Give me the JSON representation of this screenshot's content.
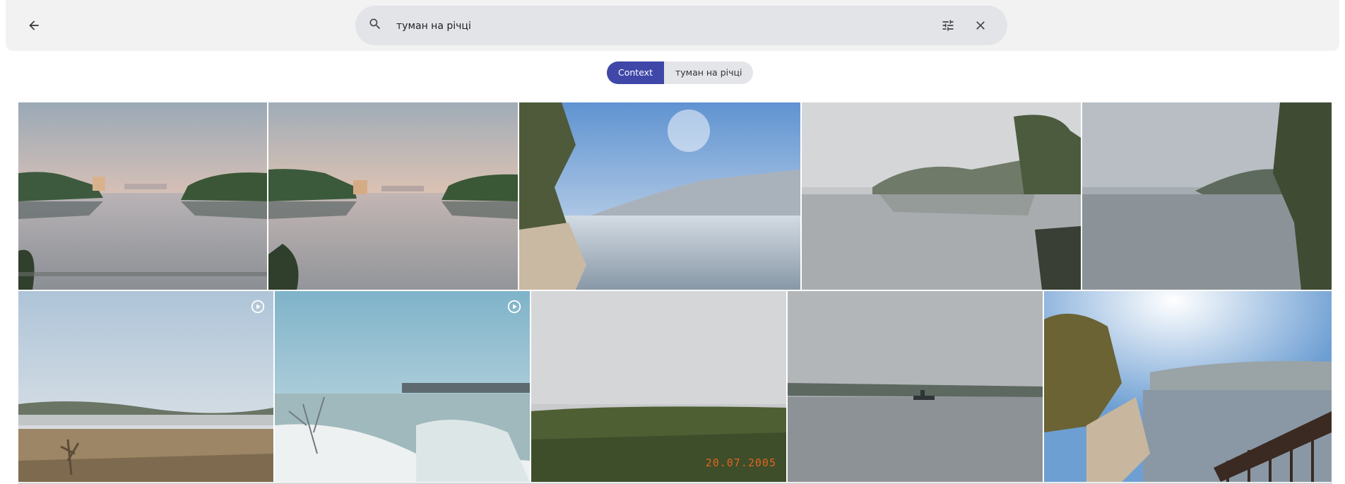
{
  "search": {
    "query": "туман на річці"
  },
  "chips": {
    "context_label": "Context",
    "query_label": "туман на річці"
  },
  "icons": {
    "back": "arrow-back-icon",
    "search": "search-icon",
    "tune": "tune-icon",
    "clear": "close-icon",
    "video": "play-circle-icon"
  },
  "colors": {
    "accent": "#3f48a8",
    "date_stamp": "#e0651f"
  },
  "photos": {
    "row1": [
      "foggy-river-dawn-city",
      "foggy-river-dawn-city-2",
      "river-bank-sunlit-haze",
      "misty-river-trees",
      "misty-river-willow"
    ],
    "row2": [
      "foggy-field-dawn",
      "frosty-river-bridge",
      "fog-over-meadow",
      "river-boat-in-fog",
      "embankment-railing-sun"
    ],
    "row2_video_flags": [
      true,
      true,
      false,
      false,
      false
    ],
    "date_stamp": "20.07.2005"
  }
}
